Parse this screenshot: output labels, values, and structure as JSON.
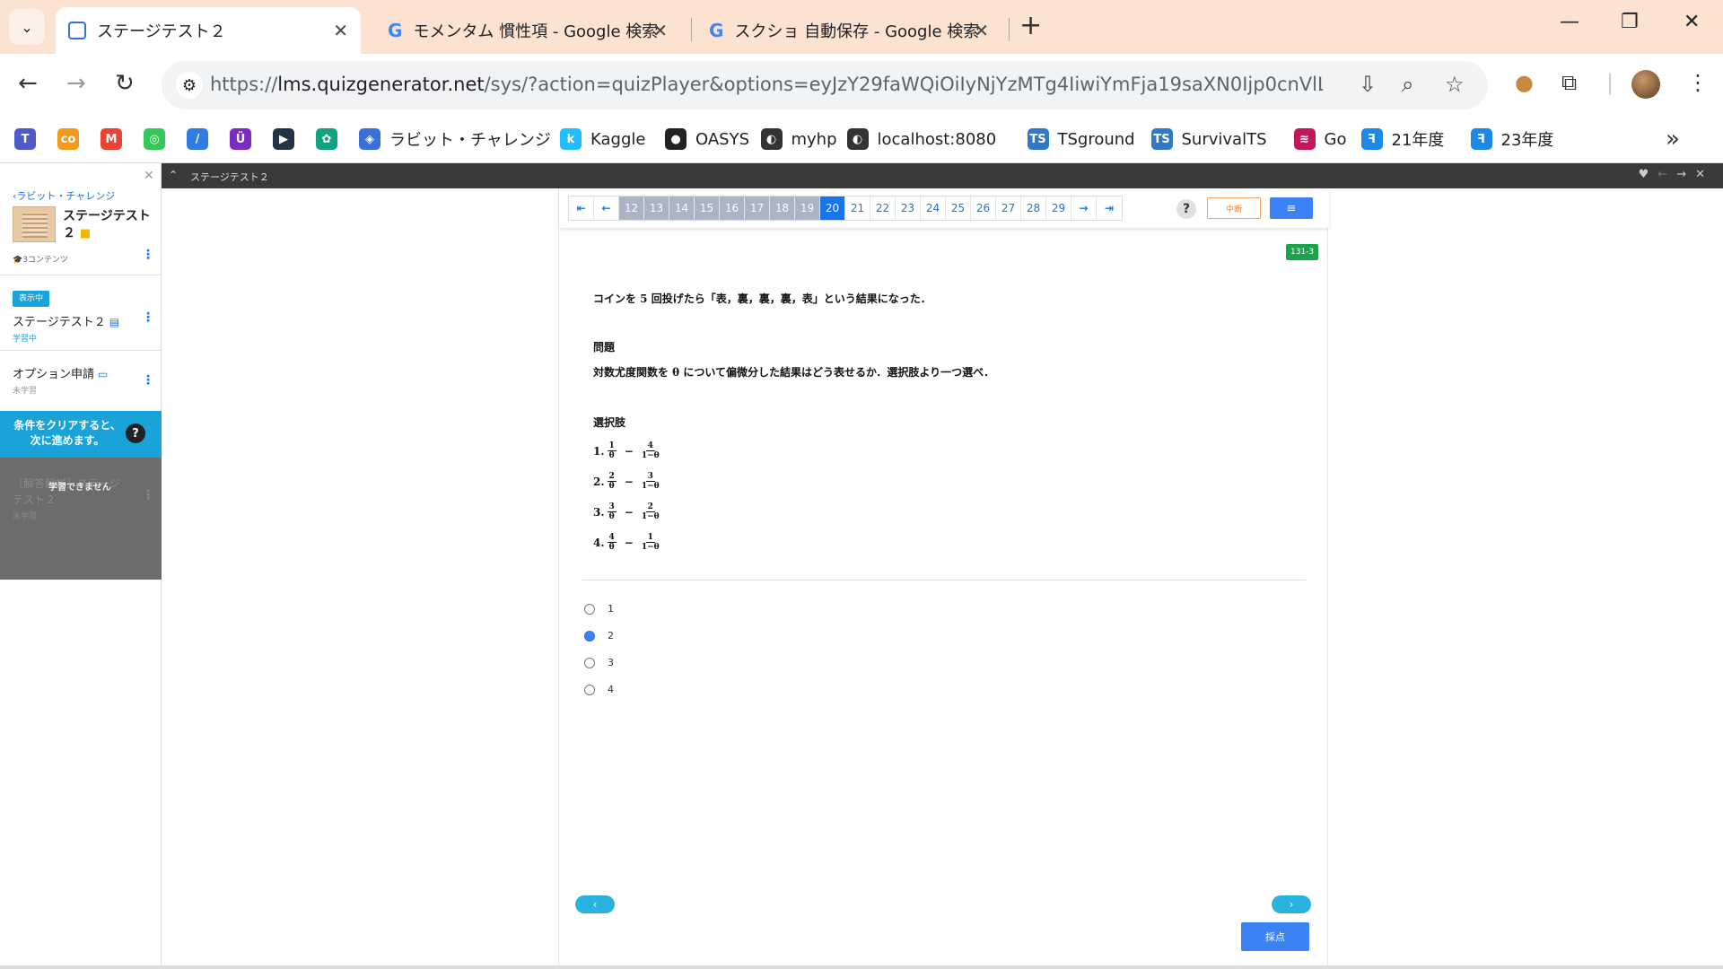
{
  "browser": {
    "tabs": [
      {
        "title": "ステージテスト２",
        "active": true
      },
      {
        "title": "モメンタム 慣性項 - Google 検索",
        "active": false
      },
      {
        "title": "スクショ 自動保存 - Google 検索",
        "active": false
      }
    ],
    "url_prefix": "https://",
    "url_host": "lms.quizgenerator.net",
    "url_rest": "/sys/?action=quizPlayer&options=eyJzY29faWQiOiIyNjYzMTg4IiwiYmFja19saXN0Ijp0cnVlLCJoZWFkZXIiOn...",
    "bookmarks": [
      {
        "label": "",
        "icon": "teams-icon",
        "color": "#5059c9"
      },
      {
        "label": "",
        "icon": "co-icon",
        "color": "#f39a1c"
      },
      {
        "label": "",
        "icon": "gmail-icon",
        "color": "#ea4335"
      },
      {
        "label": "",
        "icon": "green-circle-icon",
        "color": "#34c759"
      },
      {
        "label": "",
        "icon": "slash-icon",
        "color": "#2f7de1"
      },
      {
        "label": "",
        "icon": "purple-u-icon",
        "color": "#7b2cbf"
      },
      {
        "label": "",
        "icon": "dark-play-icon",
        "color": "#223344"
      },
      {
        "label": "",
        "icon": "chatgpt-icon",
        "color": "#10a37f"
      },
      {
        "label": "ラビット・チャレンジ",
        "icon": "rabbit-icon",
        "color": "#3b6fd8"
      },
      {
        "label": "Kaggle",
        "icon": "kaggle-icon",
        "color": "#20beff"
      },
      {
        "label": "OASYS",
        "icon": "oasys-icon",
        "color": "#222222"
      },
      {
        "label": "myhp",
        "icon": "globe-icon",
        "color": "#333333"
      },
      {
        "label": "localhost:8080",
        "icon": "globe-icon",
        "color": "#333333"
      },
      {
        "label": "TSground",
        "icon": "ts-icon",
        "color": "#3178c6"
      },
      {
        "label": "SurvivalTS",
        "icon": "ts-icon",
        "color": "#3178c6"
      },
      {
        "label": "Go",
        "icon": "go-icon",
        "color": "#c2185b"
      },
      {
        "label": "21年度",
        "icon": "f-icon",
        "color": "#1e88e5"
      },
      {
        "label": "23年度",
        "icon": "f-icon",
        "color": "#1e88e5"
      }
    ]
  },
  "sidebar": {
    "back_label": "‹ラビット・チャレンジ",
    "course_title": "ステージテスト２",
    "content_count": "🎓3コンテンツ",
    "current_badge": "表示中",
    "items": [
      {
        "label": "ステージテスト２",
        "status": "学習中",
        "status_color": "#1aa3d9"
      },
      {
        "label": "オプション申請",
        "status": "未学習",
        "status_color": "#999999"
      }
    ],
    "cta_line1": "条件をクリアすると、",
    "cta_line2": "次に進めます。",
    "locked_item": "［解答解説］ステージテスト２",
    "locked_msg": "学習できません",
    "locked_status": "未学習"
  },
  "content_bar": {
    "title": "ステージテスト２"
  },
  "quiz": {
    "pager": [
      "12",
      "13",
      "14",
      "15",
      "16",
      "17",
      "18",
      "19",
      "20",
      "21",
      "22",
      "23",
      "24",
      "25",
      "26",
      "27",
      "28",
      "29"
    ],
    "visited_until": "19",
    "current": "20",
    "suspend_label": "中断",
    "list_icon": "≡",
    "question_id": "131-3",
    "intro": "コインを 5 回投げたら「表，裏，裏，裏，表」という結果になった．",
    "problem_heading": "問題",
    "problem": "対数尤度関数を θ について偏微分した結果はどう表せるか．選択肢より一つ選べ．",
    "choices_heading": "選択肢",
    "choices": [
      {
        "no": "1.",
        "a": "1",
        "b": "4"
      },
      {
        "no": "2.",
        "a": "2",
        "b": "3"
      },
      {
        "no": "3.",
        "a": "3",
        "b": "2"
      },
      {
        "no": "4.",
        "a": "4",
        "b": "1"
      }
    ],
    "theta": "θ",
    "one_minus_theta": "1−θ",
    "answers": [
      "1",
      "2",
      "3",
      "4"
    ],
    "selected": "2",
    "prev_label": "‹",
    "next_label": "›",
    "grade_label": "採点"
  }
}
